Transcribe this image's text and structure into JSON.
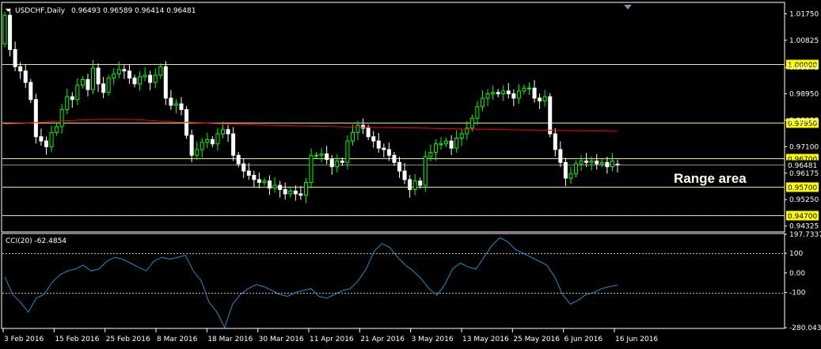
{
  "header": {
    "symbol": "USDCHF,Daily",
    "ohlc": "0.96493 0.96589 0.96414 0.96481"
  },
  "indicator": {
    "label": "CCI(20) -62.4854"
  },
  "annotation": "Range area",
  "colors": {
    "background": "#000000",
    "bull": "#00ff00",
    "bear": "#ffffff",
    "ma": "#ff0000",
    "level_line": "#e8e870",
    "level_box": "#ffff00",
    "cci": "#1e90c8",
    "axis": "#ffffff"
  },
  "chart_data": [
    {
      "type": "candlestick",
      "title": "USDCHF,Daily",
      "ylim": [
        0.9412,
        1.0215
      ],
      "price_ticks": [
        "1.01750",
        "1.00825",
        "0.99875",
        "0.98950",
        "0.98025",
        "0.97100",
        "0.96175",
        "0.95250",
        "0.94325"
      ],
      "levels": [
        {
          "value": 1.0,
          "label": "1.00000"
        },
        {
          "value": 0.9795,
          "label": "0.97950"
        },
        {
          "value": 0.967,
          "label": "0.96700"
        },
        {
          "value": 0.957,
          "label": "0.95700"
        },
        {
          "value": 0.947,
          "label": "0.94700"
        }
      ],
      "bid": {
        "value": 0.96481,
        "label": "0.96481"
      },
      "x_labels": [
        "3 Feb 2016",
        "15 Feb 2016",
        "25 Feb 2016",
        "8 Mar 2016",
        "18 Mar 2016",
        "30 Mar 2016",
        "11 Apr 2016",
        "21 Apr 2016",
        "3 May 2016",
        "13 May 2016",
        "25 May 2016",
        "6 Jun 2016",
        "16 Jun 2016"
      ],
      "close": [
        1.017,
        1.005,
        0.999,
        0.9975,
        0.9935,
        0.9875,
        0.9745,
        0.973,
        0.971,
        0.976,
        0.978,
        0.984,
        0.9885,
        0.9875,
        0.9925,
        0.9945,
        0.991,
        0.9985,
        0.993,
        0.99,
        0.995,
        0.9965,
        0.998,
        0.9975,
        0.995,
        0.993,
        0.9955,
        0.996,
        0.9935,
        0.996,
        0.999,
        0.988,
        0.9855,
        0.986,
        0.984,
        0.975,
        0.968,
        0.97,
        0.9725,
        0.9735,
        0.972,
        0.9755,
        0.977,
        0.9755,
        0.968,
        0.965,
        0.9625,
        0.961,
        0.9595,
        0.9585,
        0.959,
        0.9565,
        0.9575,
        0.956,
        0.9545,
        0.9555,
        0.9545,
        0.954,
        0.9585,
        0.968,
        0.968,
        0.9685,
        0.9665,
        0.964,
        0.966,
        0.9655,
        0.973,
        0.976,
        0.9785,
        0.9775,
        0.9745,
        0.973,
        0.9705,
        0.97,
        0.968,
        0.9655,
        0.9625,
        0.9595,
        0.956,
        0.959,
        0.9575,
        0.9675,
        0.969,
        0.972,
        0.972,
        0.973,
        0.9705,
        0.974,
        0.9755,
        0.9775,
        0.981,
        0.985,
        0.988,
        0.9895,
        0.99,
        0.9895,
        0.9905,
        0.9895,
        0.988,
        0.9905,
        0.9915,
        0.9915,
        0.988,
        0.987,
        0.9885,
        0.9755,
        0.97,
        0.9655,
        0.96,
        0.9615,
        0.965,
        0.966,
        0.9655,
        0.966,
        0.965,
        0.9655,
        0.964,
        0.966,
        0.9648
      ],
      "open": [
        1.007,
        1.017,
        1.005,
        0.999,
        0.9975,
        0.9935,
        0.9875,
        0.9745,
        0.973,
        0.971,
        0.976,
        0.978,
        0.984,
        0.9885,
        0.9875,
        0.9925,
        0.9945,
        0.991,
        0.9985,
        0.993,
        0.99,
        0.995,
        0.9965,
        0.998,
        0.9975,
        0.995,
        0.993,
        0.9955,
        0.996,
        0.9935,
        0.996,
        0.999,
        0.988,
        0.9855,
        0.986,
        0.984,
        0.975,
        0.968,
        0.97,
        0.9725,
        0.9735,
        0.972,
        0.9755,
        0.977,
        0.9755,
        0.968,
        0.965,
        0.9625,
        0.961,
        0.9595,
        0.9585,
        0.959,
        0.9565,
        0.9575,
        0.956,
        0.9545,
        0.9555,
        0.9545,
        0.954,
        0.9585,
        0.968,
        0.968,
        0.9685,
        0.9665,
        0.964,
        0.966,
        0.9655,
        0.973,
        0.976,
        0.9785,
        0.9775,
        0.9745,
        0.973,
        0.9705,
        0.97,
        0.968,
        0.9655,
        0.9625,
        0.9595,
        0.956,
        0.959,
        0.9575,
        0.9675,
        0.969,
        0.972,
        0.972,
        0.973,
        0.9705,
        0.974,
        0.9755,
        0.9775,
        0.981,
        0.985,
        0.988,
        0.9895,
        0.99,
        0.9895,
        0.9905,
        0.9895,
        0.988,
        0.9905,
        0.9915,
        0.9915,
        0.988,
        0.987,
        0.9885,
        0.9755,
        0.97,
        0.9655,
        0.96,
        0.9615,
        0.965,
        0.966,
        0.9655,
        0.966,
        0.965,
        0.9655,
        0.964,
        0.9649
      ],
      "ma": [
        0.979,
        0.9792,
        0.9796,
        0.98,
        0.9803,
        0.9806,
        0.9806,
        0.9804,
        0.98,
        0.9796,
        0.9794,
        0.9791,
        0.9789,
        0.9787,
        0.9785,
        0.9784,
        0.9782,
        0.9781,
        0.9779,
        0.9778,
        0.9777,
        0.9776,
        0.9775,
        0.9773,
        0.9772,
        0.9771,
        0.977,
        0.9769,
        0.9768,
        0.9767,
        0.9766,
        0.9765,
        0.9764
      ]
    },
    {
      "type": "line",
      "title": "CCI(20) -62.4854",
      "ylim": [
        -280.0437,
        197.7337
      ],
      "ticks": [
        "197.7337",
        "100",
        "0.00",
        "-100",
        "-280.0437"
      ],
      "levels": [
        100,
        -100
      ],
      "values": [
        -20,
        -110,
        -150,
        -200,
        -130,
        -110,
        -50,
        -10,
        10,
        20,
        40,
        10,
        20,
        60,
        80,
        70,
        50,
        30,
        10,
        60,
        80,
        70,
        80,
        90,
        10,
        -40,
        -150,
        -200,
        -280,
        -160,
        -110,
        -80,
        -60,
        -70,
        -90,
        -110,
        -120,
        -100,
        -90,
        -80,
        -120,
        -130,
        -110,
        -90,
        -80,
        -40,
        20,
        110,
        150,
        130,
        80,
        40,
        10,
        -30,
        -80,
        -115,
        -60,
        20,
        50,
        30,
        20,
        80,
        140,
        180,
        160,
        120,
        100,
        80,
        60,
        40,
        -20,
        -110,
        -160,
        -140,
        -110,
        -100,
        -80,
        -70,
        -62
      ]
    }
  ]
}
